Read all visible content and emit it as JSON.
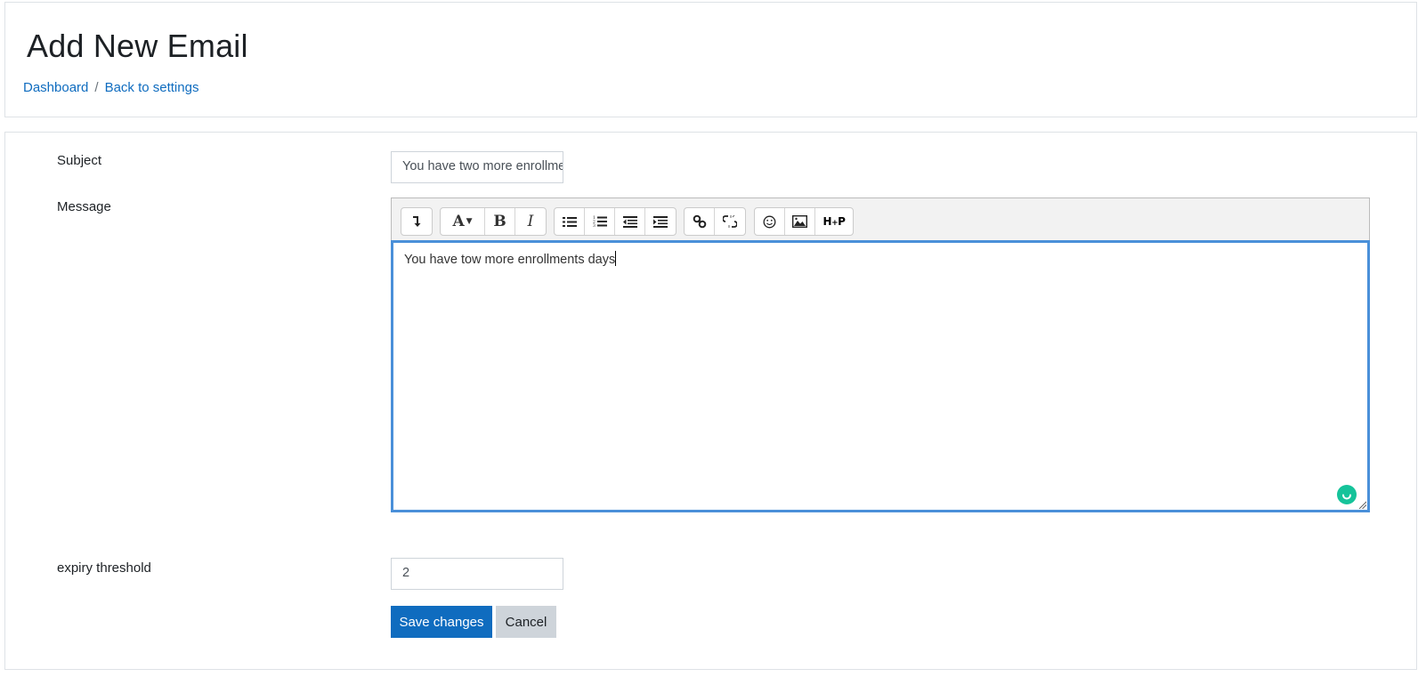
{
  "header": {
    "title": "Add New Email",
    "breadcrumb": [
      {
        "label": "Dashboard"
      },
      {
        "label": "Back to settings"
      }
    ],
    "breadcrumb_separator": "/"
  },
  "form": {
    "subject": {
      "label": "Subject",
      "value": "You have two more enrollments days"
    },
    "message": {
      "label": "Message",
      "value": "You have tow more enrollments days",
      "toolbar": [
        {
          "name": "toolbar-toggle",
          "glyph": "↴"
        },
        {
          "name": "font-color",
          "glyph": "A▾"
        },
        {
          "name": "bold",
          "glyph": "B"
        },
        {
          "name": "italic",
          "glyph": "I"
        },
        {
          "name": "unordered-list",
          "glyph": "☰"
        },
        {
          "name": "ordered-list",
          "glyph": "☰"
        },
        {
          "name": "outdent",
          "glyph": "⇤"
        },
        {
          "name": "indent",
          "glyph": "⇥"
        },
        {
          "name": "link",
          "glyph": "🔗"
        },
        {
          "name": "unlink",
          "glyph": "⛓"
        },
        {
          "name": "emoticon",
          "glyph": "☺"
        },
        {
          "name": "image",
          "glyph": "▲"
        },
        {
          "name": "h5p",
          "glyph": "H5P"
        }
      ]
    },
    "expiry_threshold": {
      "label": "expiry threshold",
      "value": "2"
    },
    "buttons": {
      "save": "Save changes",
      "cancel": "Cancel"
    }
  },
  "colors": {
    "primary": "#0f6cbf",
    "secondary": "#ced4da",
    "focus_border": "#4a90d9",
    "grammar_badge": "#15c39a"
  }
}
